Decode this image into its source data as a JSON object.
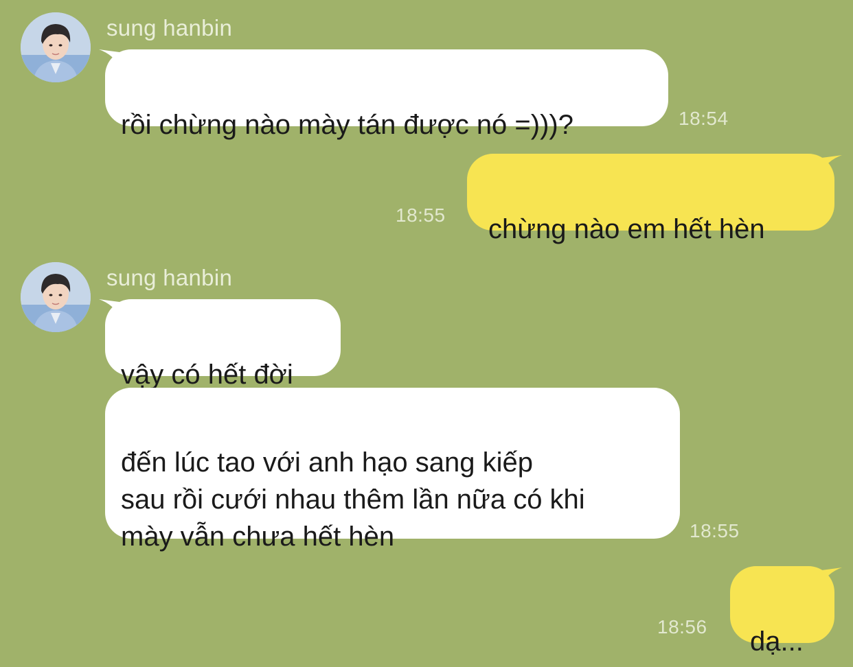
{
  "theme": {
    "background": "#a0b26a",
    "incoming_bubble": "#ffffff",
    "outgoing_bubble": "#f7e452",
    "meta_text": "#e2e8cf"
  },
  "groups": [
    {
      "sender": "sung hanbin",
      "messages": [
        {
          "text": "rồi chừng nào mày tán được nó =)))?",
          "time": "18:54"
        }
      ]
    },
    {
      "sender": "me",
      "messages": [
        {
          "text": "chừng nào em hết hèn",
          "time": "18:55"
        }
      ]
    },
    {
      "sender": "sung hanbin",
      "messages": [
        {
          "text": "vậy có hết đời",
          "time": ""
        },
        {
          "text": "đến lúc tao với anh hạo sang kiếp\nsau rồi cưới nhau thêm lần nữa có khi\nmày vẫn chưa hết hèn",
          "time": "18:55"
        }
      ]
    },
    {
      "sender": "me",
      "messages": [
        {
          "text": "dạ...",
          "time": "18:56"
        }
      ]
    }
  ]
}
